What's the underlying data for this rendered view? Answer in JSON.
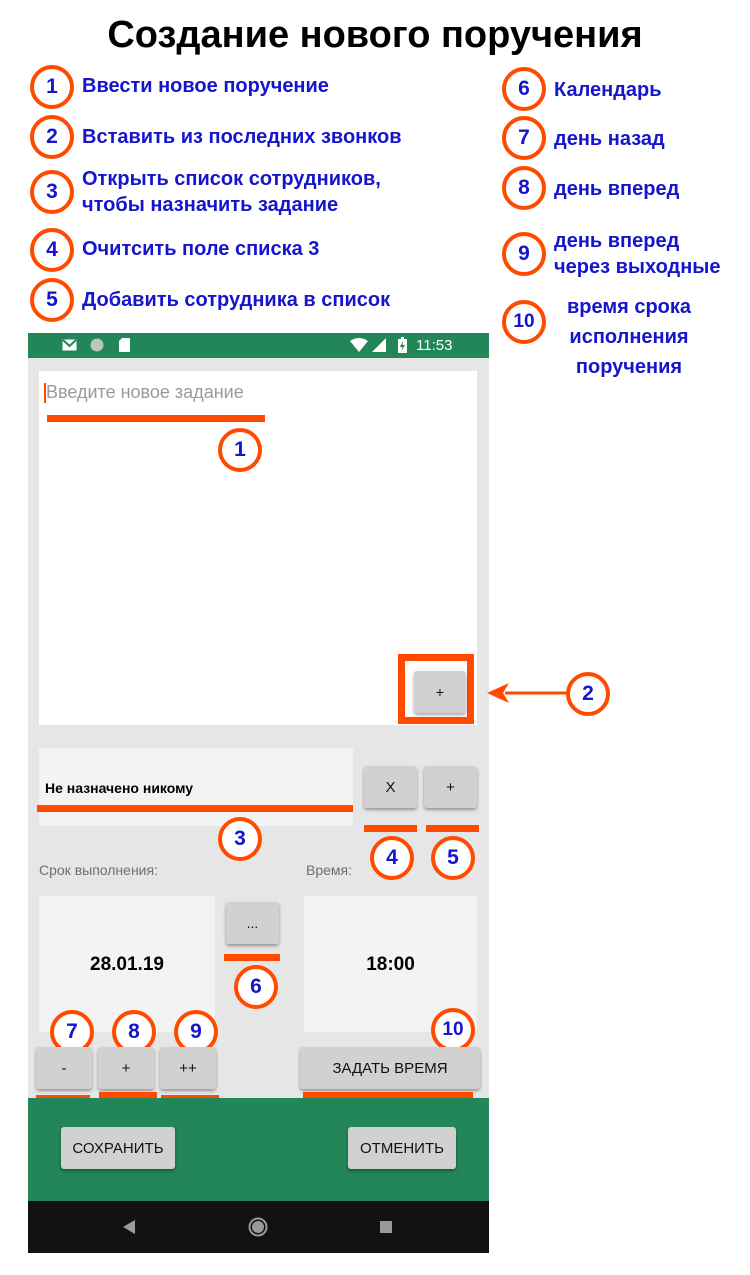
{
  "header": {
    "title": "Создание нового поручения"
  },
  "legend": [
    {
      "num": "1",
      "text": "Ввести новое поручение"
    },
    {
      "num": "2",
      "text": "Вставить из последних звонков"
    },
    {
      "num": "3",
      "text": "Открыть список сотрудников,\nчтобы назначить задание"
    },
    {
      "num": "4",
      "text": "Очитсить поле списка 3"
    },
    {
      "num": "5",
      "text": "Добавить сотрудника в список"
    },
    {
      "num": "6",
      "text": "Календарь"
    },
    {
      "num": "7",
      "text": "день назад"
    },
    {
      "num": "8",
      "text": "день вперед"
    },
    {
      "num": "9",
      "text": "день вперед\nчерез выходные"
    },
    {
      "num": "10",
      "text": "время срока\nисполнения\nпоручения"
    }
  ],
  "statusbar": {
    "time": "11:53",
    "icons": [
      "gmail-icon",
      "circle-icon",
      "sd-card-icon",
      "wifi-icon",
      "signal-icon",
      "battery-icon"
    ]
  },
  "task": {
    "placeholder": "Введите новое задание",
    "paste_label": "+"
  },
  "assignee": {
    "text": "Не назначено никому",
    "clear_label": "X",
    "add_label": "+"
  },
  "deadline": {
    "date_label": "Срок выполнения:",
    "time_label": "Время:",
    "date": "28.01.19",
    "time": "18:00",
    "calendar_label": "...",
    "back_label": "-",
    "fwd_label": "+",
    "fwd_weekend_label": "++",
    "set_time_label": "ЗАДАТЬ ВРЕМЯ"
  },
  "actions": {
    "save_label": "СОХРАНИТЬ",
    "cancel_label": "ОТМЕНИТЬ"
  },
  "colors": {
    "accent": "#ff4a00",
    "legend_text": "#1515cc",
    "statusbar": "#238658",
    "navbar": "#121212"
  }
}
